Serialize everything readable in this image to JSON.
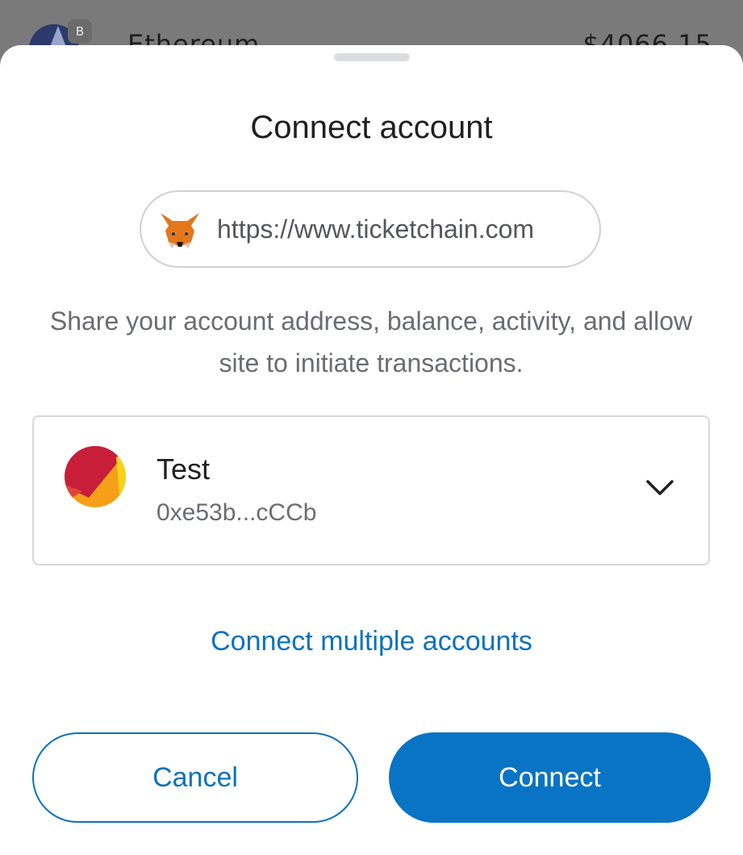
{
  "background": {
    "token_badge": "B",
    "token_name": "Ethereum",
    "token_value": "$4066.15"
  },
  "modal": {
    "title": "Connect account",
    "site_url": "https://www.ticketchain.com",
    "description": "Share your account address, balance, activity, and allow site to initiate transactions.",
    "account": {
      "name": "Test",
      "address": "0xe53b...cCCb"
    },
    "connect_multiple_label": "Connect multiple accounts",
    "cancel_label": "Cancel",
    "connect_label": "Connect"
  },
  "colors": {
    "accent": "#0a74c4",
    "link": "#0b72bd",
    "overlay": "#7a7a7a"
  },
  "icons": [
    "metamask-fox-icon",
    "identicon-avatar",
    "chevron-down-icon"
  ]
}
